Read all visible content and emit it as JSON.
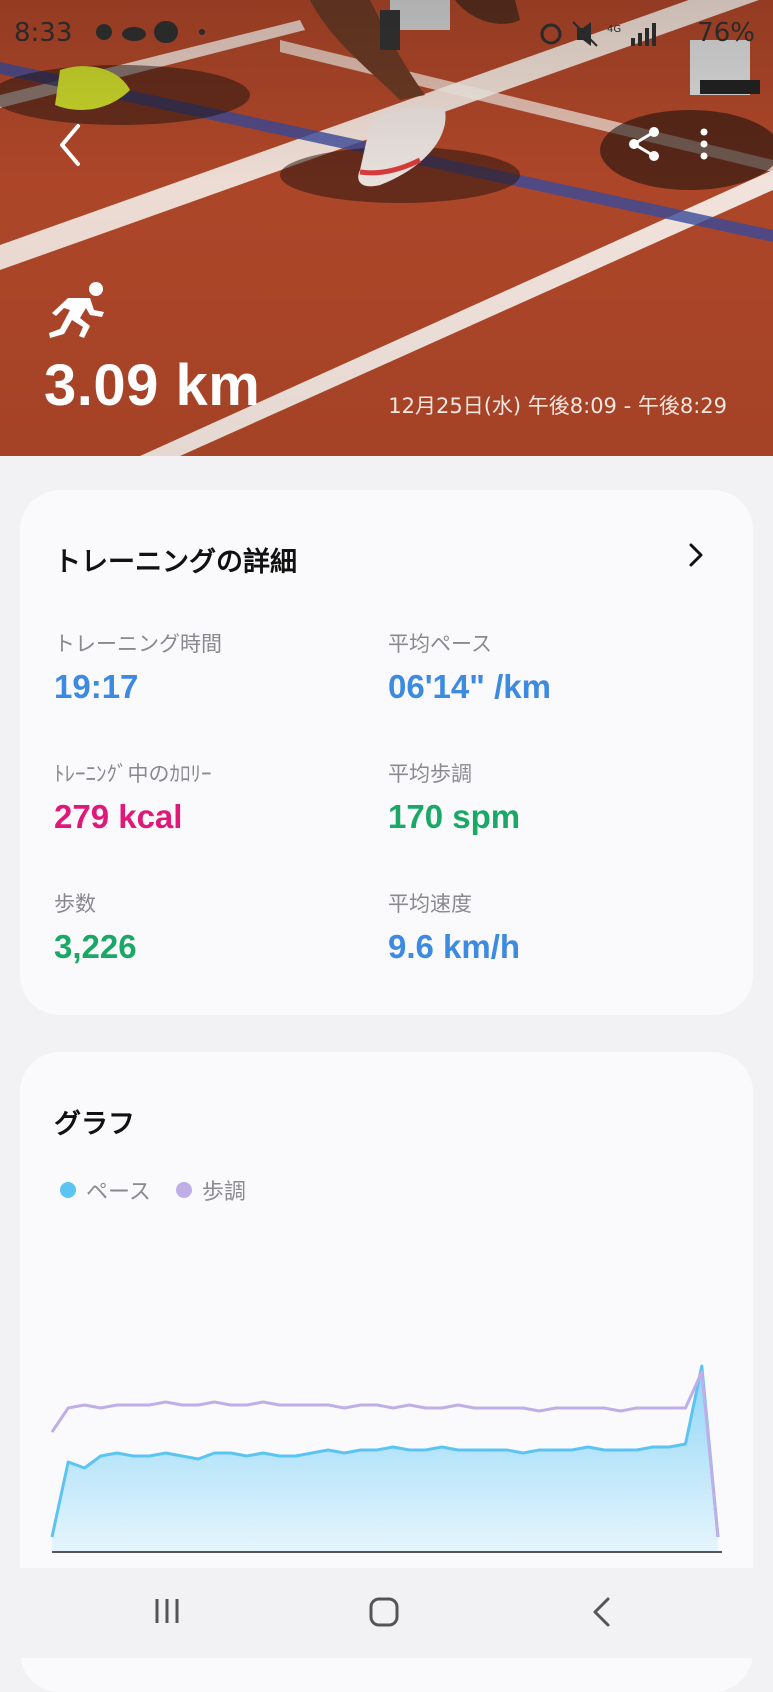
{
  "status_bar": {
    "time": "8:33",
    "battery": "76%",
    "network": "4G"
  },
  "hero": {
    "distance": "3.09 km",
    "datetime": "12月25日(水) 午後8:09 - 午後8:29"
  },
  "details": {
    "title": "トレーニングの詳細",
    "metrics": [
      {
        "label": "トレーニング時間",
        "value": "19:17",
        "color": "#3d8be0"
      },
      {
        "label": "平均ペース",
        "value": "06'14\" /km",
        "color": "#3d8be0"
      },
      {
        "label": "ﾄﾚｰﾆﾝｸﾞ中のｶﾛﾘｰ",
        "value": "279 kcal",
        "color": "#e0187a"
      },
      {
        "label": "平均歩調",
        "value": "170 spm",
        "color": "#1aa866"
      },
      {
        "label": "歩数",
        "value": "3,226",
        "color": "#1aa866"
      },
      {
        "label": "平均速度",
        "value": "9.6 km/h",
        "color": "#3d8be0"
      }
    ]
  },
  "graph": {
    "title": "グラフ",
    "legend": [
      {
        "label": "ペース",
        "color": "#5cc4f2"
      },
      {
        "label": "歩調",
        "color": "#c0aee8"
      }
    ]
  },
  "chart_data": {
    "type": "area",
    "series": [
      {
        "name": "ペース",
        "values": [
          0.05,
          0.3,
          0.28,
          0.32,
          0.33,
          0.32,
          0.32,
          0.33,
          0.32,
          0.31,
          0.33,
          0.33,
          0.32,
          0.33,
          0.32,
          0.32,
          0.33,
          0.34,
          0.33,
          0.34,
          0.34,
          0.35,
          0.34,
          0.34,
          0.35,
          0.34,
          0.34,
          0.34,
          0.34,
          0.33,
          0.34,
          0.34,
          0.34,
          0.35,
          0.34,
          0.34,
          0.34,
          0.35,
          0.35,
          0.36,
          0.62,
          0.05
        ]
      },
      {
        "name": "歩調",
        "values": [
          0.4,
          0.48,
          0.49,
          0.48,
          0.49,
          0.49,
          0.49,
          0.5,
          0.49,
          0.49,
          0.5,
          0.49,
          0.49,
          0.5,
          0.49,
          0.49,
          0.49,
          0.49,
          0.48,
          0.49,
          0.49,
          0.48,
          0.49,
          0.48,
          0.48,
          0.49,
          0.48,
          0.48,
          0.48,
          0.48,
          0.47,
          0.48,
          0.48,
          0.48,
          0.48,
          0.47,
          0.48,
          0.48,
          0.48,
          0.48,
          0.6,
          0.05
        ]
      }
    ]
  }
}
